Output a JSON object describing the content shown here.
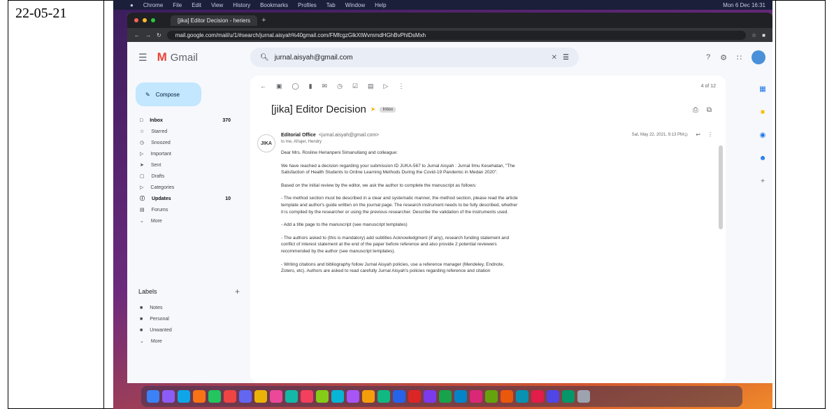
{
  "date": "22-05-21",
  "mac_menu": [
    "Chrome",
    "File",
    "Edit",
    "View",
    "History",
    "Bookmarks",
    "Profiles",
    "Tab",
    "Window",
    "Help"
  ],
  "mac_clock": "Mon 6 Dec 16:31",
  "tab_title": "[jika] Editor Decision - heriers",
  "url": "mail.google.com/mail/u/1/#search/jurnal.aisyah%40gmail.com/FMfcgzGlkXtWvmmdHGhBvPhlDsMxh",
  "gmail_label": "Gmail",
  "search_value": "jurnal.aisyah@gmail.com",
  "compose_label": "Compose",
  "nav": [
    {
      "label": "Inbox",
      "count": "370",
      "bold": true
    },
    {
      "label": "Starred",
      "count": ""
    },
    {
      "label": "Snoozed",
      "count": ""
    },
    {
      "label": "Important",
      "count": ""
    },
    {
      "label": "Sent",
      "count": ""
    },
    {
      "label": "Drafts",
      "count": ""
    },
    {
      "label": "Categories",
      "count": ""
    },
    {
      "label": "Updates",
      "count": "10",
      "bold": true
    },
    {
      "label": "Forums",
      "count": ""
    },
    {
      "label": "More",
      "count": ""
    }
  ],
  "labels_heading": "Labels",
  "labels": [
    "Notes",
    "Personal",
    "Unwanted",
    "More"
  ],
  "pagination": "4 of 12",
  "subject": "[jika] Editor Decision",
  "subject_chip": "Inbox",
  "sender_name": "Editorial Office",
  "sender_addr": "<jurnal.aisyah@gmail.com>",
  "to_line": "to me, Afrajer, Hendry",
  "msg_date": "Sat, May 22, 2021, 9:13 PM",
  "avatar_text": "JIKA",
  "body": [
    "Dear Mrs. Rosline Herianpeni Simanullang and colleague:",
    "We have reached a decision regarding your submission ID JUKA-567 to Jurnal Aisyah : Jurnal Ilmu Kesehatan, \"The Satisfaction of Health Students to Online Learning Methods During the Covid-19 Pandemic in Medan 2020\".",
    "Based on the initial review by the editor, we ask the author to complete the manuscript as follows:",
    "- The method section must be described in a clear and systematic manner, the method section, please read the article template and author's guide written on the journal page. The research instrument needs to be fully described, whether it is compiled by the researcher or using the previous researcher. Describe the validation of the instruments used.",
    "- Add a title page to the manuscript (see manuscript templates)",
    "- The authors asked to (this is mandatory) add subtitles Acknowledgment (if any), research funding statement and conflict of interest statement at the end of the paper before reference and also provide 2 potential reviewers recommended by the author (see manuscript templates).",
    "- Writing citations and bibliography follow Jurnal Aisyah policies, use a reference manager (Mendeley, Endnote, Zotero, etc). Authors are asked to read carefully Jurnal Aisyah's policies regarding reference and citation"
  ]
}
